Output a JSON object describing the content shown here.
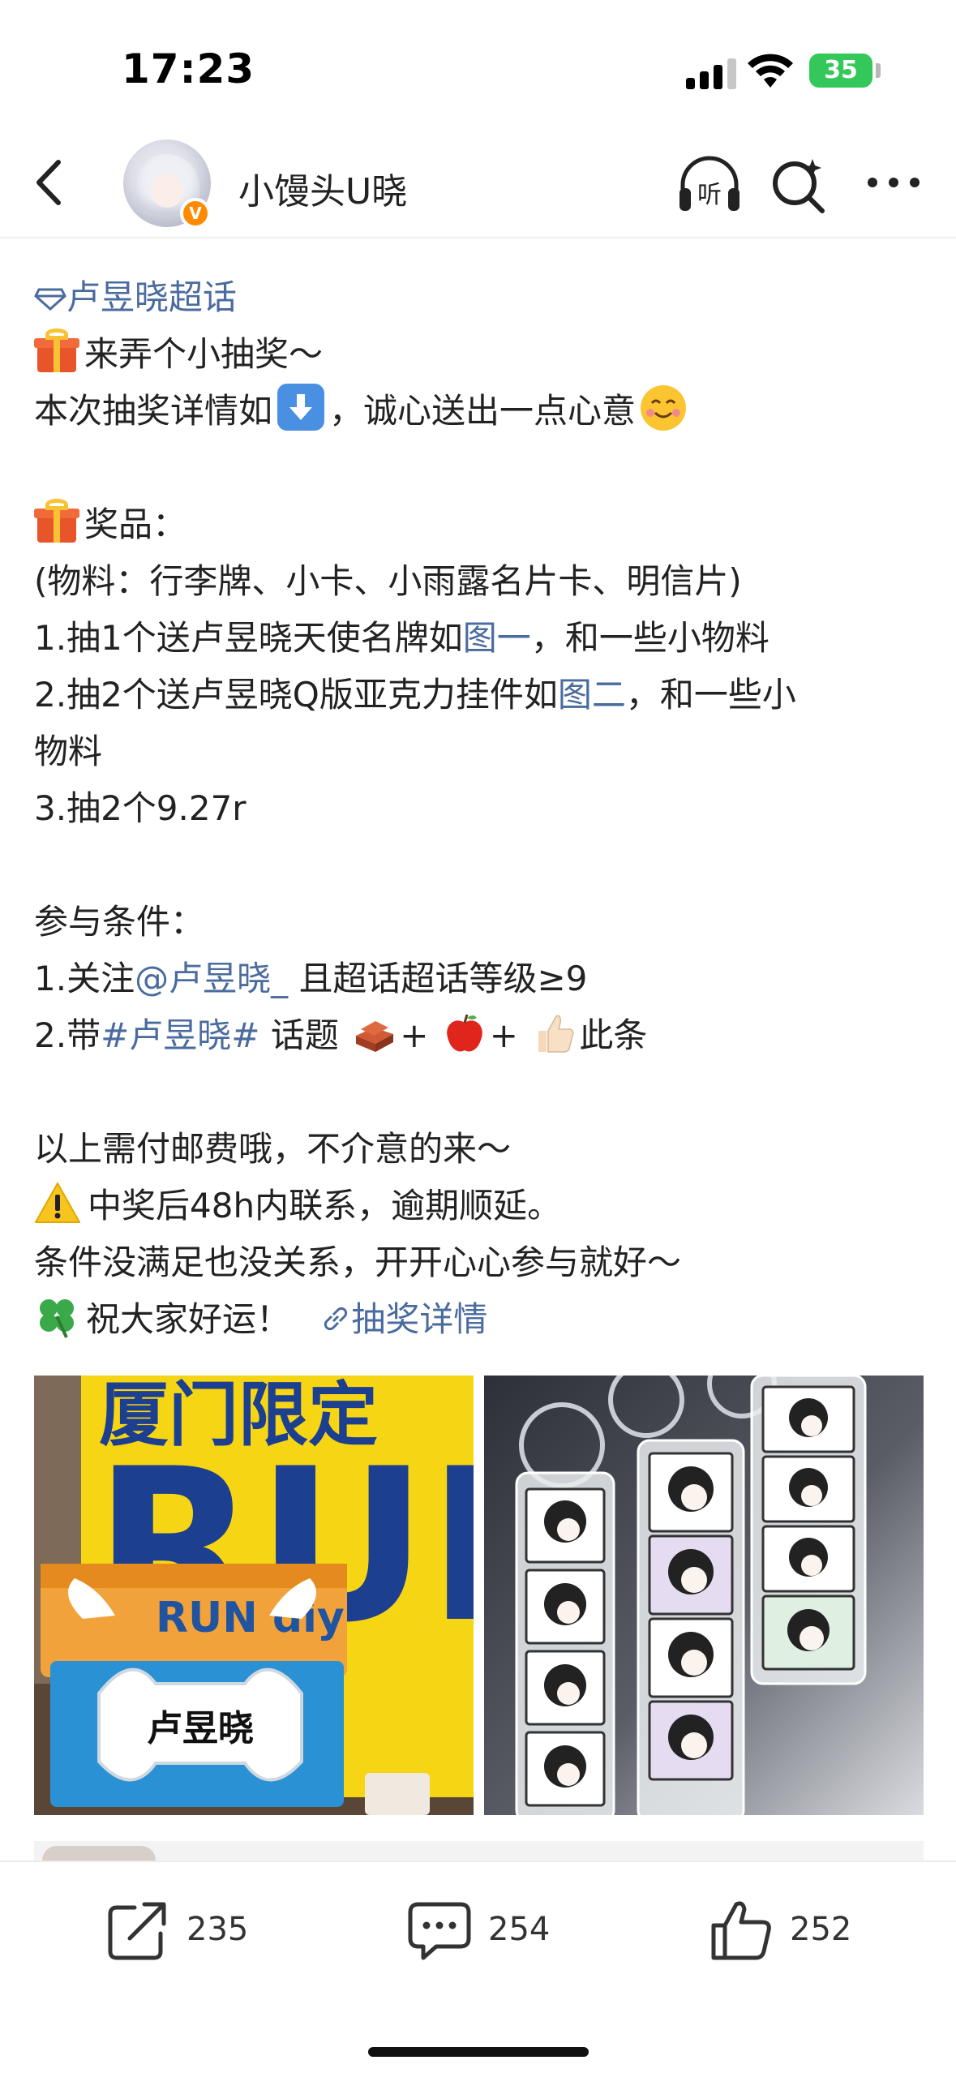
{
  "status_bar": {
    "time": "17:23",
    "battery": "35"
  },
  "nav": {
    "username": "小馒头U晓",
    "listen_icon_label": "听"
  },
  "post": {
    "topic_link": "卢昱晓超话",
    "line_intro": "来弄个小抽奖～",
    "line_detail_a": "本次抽奖详情如",
    "line_detail_b": "，诚心送出一点心意",
    "prize_heading": "奖品：",
    "materials": "(物料：行李牌、小卡、小雨露名片卡、明信片)",
    "prize1_a": "1.抽1个送卢昱晓天使名牌如",
    "prize1_link": "图一",
    "prize1_b": "，和一些小物料",
    "prize2_a": "2.抽2个送卢昱晓Q版亚克力挂件如",
    "prize2_link": "图二",
    "prize2_b": "，和一些小",
    "prize2_c": "物料",
    "prize3": "3.抽2个9.27r",
    "cond_heading": "参与条件：",
    "cond1_a": "1.关注",
    "cond1_link": "@卢昱晓_",
    "cond1_b": " 且超话超话等级≥9",
    "cond2_a": "2.带",
    "cond2_link": "#卢昱晓#",
    "cond2_b": " 话题",
    "cond2_plus1": "+",
    "cond2_plus2": "+",
    "cond2_c": "此条",
    "note1": "以上需付邮费哦，不介意的来～",
    "note2": "中奖后48h内联系，逾期顺延。",
    "note3": "条件没满足也没关系，开开心心参与就好～",
    "note4": "祝大家好运！",
    "lottery_link": "抽奖详情"
  },
  "images": {
    "left": {
      "bag_text_top": "厦门限定",
      "bag_letters": "RUN",
      "card_title": "RUN diy",
      "badge_name": "卢昱晓"
    }
  },
  "toolbar": {
    "repost_count": "235",
    "comment_count": "254",
    "like_count": "252"
  },
  "colors": {
    "link": "#4a6b9e",
    "badge": "#ff8a00",
    "battery": "#34c759"
  }
}
